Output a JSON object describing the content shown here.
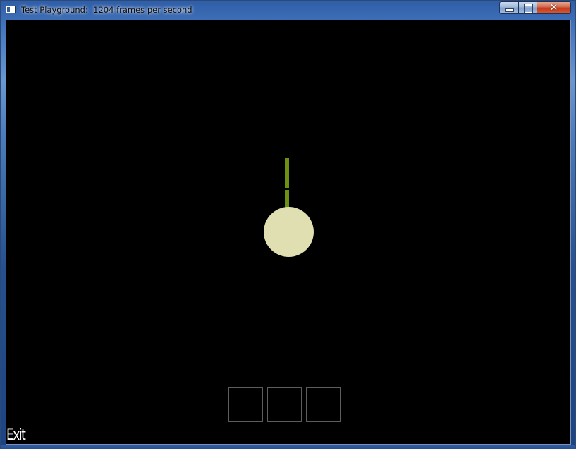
{
  "window": {
    "title": "Test Playground:  1204 frames per second",
    "controls": {
      "minimize_icon": "minimize-icon",
      "maximize_icon": "maximize-icon",
      "close_label": "✕"
    }
  },
  "game": {
    "background_color": "#000000",
    "ball_color": "#dfdfb1",
    "stick_color": "#6f8f10",
    "inventory_slots": [
      {
        "id": 1,
        "content": ""
      },
      {
        "id": 2,
        "content": ""
      },
      {
        "id": 3,
        "content": ""
      }
    ],
    "exit_label": "Exit"
  }
}
